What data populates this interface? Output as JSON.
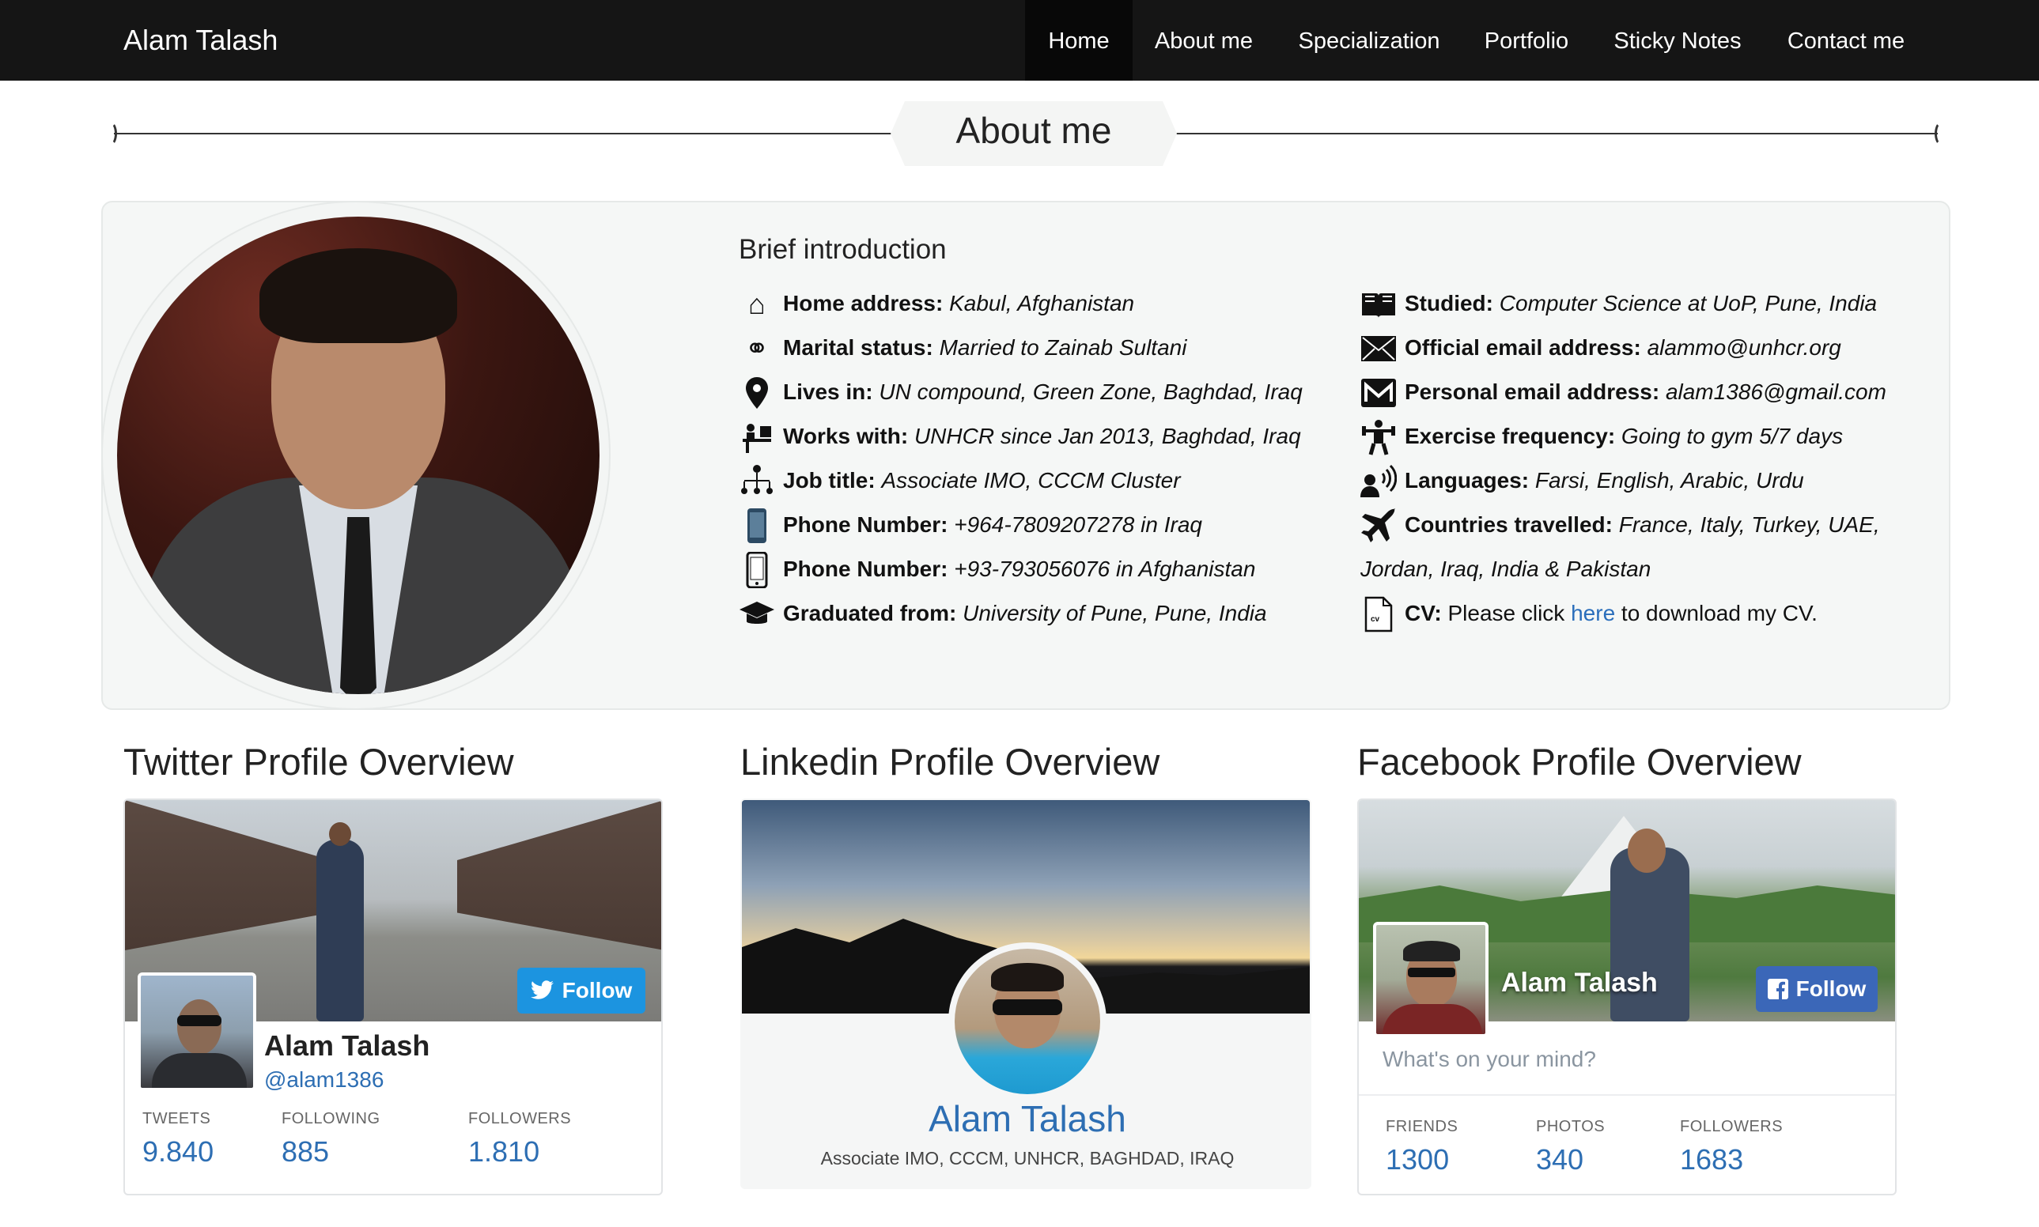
{
  "navbar": {
    "brand": "Alam Talash",
    "items": [
      {
        "label": "Home",
        "active": true
      },
      {
        "label": "About me"
      },
      {
        "label": "Specialization"
      },
      {
        "label": "Portfolio"
      },
      {
        "label": "Sticky Notes"
      },
      {
        "label": "Contact me"
      }
    ]
  },
  "section_title": "About me",
  "intro": {
    "heading": "Brief introduction",
    "left": [
      {
        "icon": "home-icon",
        "label": "Home address:",
        "value": "Kabul, Afghanistan"
      },
      {
        "icon": "rings-icon",
        "label": "Marital status:",
        "value": "Married to Zainab Sultani"
      },
      {
        "icon": "map-pin-icon",
        "label": "Lives in:",
        "value": "UN compound, Green Zone, Baghdad, Iraq"
      },
      {
        "icon": "office-worker-icon",
        "label": "Works with:",
        "value": "UNHCR since Jan 2013, Baghdad, Iraq"
      },
      {
        "icon": "org-chart-icon",
        "label": "Job title:",
        "value": "Associate IMO, CCCM Cluster"
      },
      {
        "icon": "phone-icon",
        "label": "Phone Number:",
        "value": "+964-7809207278 in Iraq"
      },
      {
        "icon": "mobile-icon",
        "label": "Phone Number:",
        "value": "+93-793056076 in Afghanistan"
      },
      {
        "icon": "graduation-cap-icon",
        "label": "Graduated from:",
        "value": "University of Pune, Pune, India"
      }
    ],
    "right": [
      {
        "icon": "book-icon",
        "label": "Studied:",
        "value": "Computer Science at UoP, Pune, India"
      },
      {
        "icon": "envelope-icon",
        "label": "Official email address:",
        "value": "alammo@unhcr.org"
      },
      {
        "icon": "gmail-icon",
        "label": "Personal email address:",
        "value": "alam1386@gmail.com"
      },
      {
        "icon": "exercise-icon",
        "label": "Exercise frequency:",
        "value": "Going to gym 5/7 days"
      },
      {
        "icon": "speaking-icon",
        "label": "Languages:",
        "value": "Farsi, English, Arabic, Urdu"
      },
      {
        "icon": "airplane-icon",
        "label": "Countries travelled:",
        "value": "France, Italy, Turkey, UAE,",
        "value_line2": "Jordan, Iraq, India & Pakistan"
      },
      {
        "icon": "cv-icon",
        "label": "CV:",
        "pre": "Please click",
        "link": "here",
        "post": "to download my CV."
      }
    ]
  },
  "social": {
    "twitter": {
      "heading": "Twitter Profile Overview",
      "follow": "Follow",
      "name": "Alam Talash",
      "handle": "@alam1386",
      "stats": [
        {
          "label": "TWEETS",
          "value": "9.840"
        },
        {
          "label": "FOLLOWING",
          "value": "885"
        },
        {
          "label": "FOLLOWERS",
          "value": "1.810"
        }
      ]
    },
    "linkedin": {
      "heading": "Linkedin Profile Overview",
      "name": "Alam Talash",
      "subtitle": "Associate IMO, CCCM, UNHCR, BAGHDAD, IRAQ"
    },
    "facebook": {
      "heading": "Facebook Profile Overview",
      "name": "Alam Talash",
      "follow": "Follow",
      "prompt": "What's on your mind?",
      "stats": [
        {
          "label": "FRIENDS",
          "value": "1300"
        },
        {
          "label": "PHOTOS",
          "value": "340"
        },
        {
          "label": "FOLLOWERS",
          "value": "1683"
        }
      ]
    }
  },
  "colors": {
    "navbar": "#151515",
    "link": "#2a6ebb",
    "twitter": "#1c94e0",
    "facebook": "#3b67b8"
  }
}
